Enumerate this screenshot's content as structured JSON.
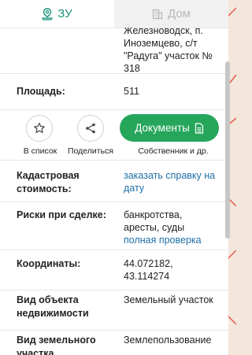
{
  "tabs": [
    {
      "label": "ЗУ",
      "icon": "land-plot-icon",
      "active": true
    },
    {
      "label": "Дом",
      "icon": "building-icon",
      "active": false
    }
  ],
  "address": {
    "lines": [
      "Железноводск, п.",
      "Иноземцево, с/т",
      "\"Радуга\" участок №",
      "318"
    ]
  },
  "area": {
    "label": "Площадь:",
    "value": "511"
  },
  "actions": {
    "favorite_label": "В список",
    "favorite_icon": "star-icon",
    "share_label": "Поделиться",
    "share_icon": "share-icon",
    "documents_label": "Документы",
    "documents_icon": "document-icon",
    "documents_sub": "Собственник и др."
  },
  "cadastral": {
    "label_lines": [
      "Кадастровая",
      "стоимость:"
    ],
    "link_lines": [
      "заказать справку на",
      "дату"
    ]
  },
  "risks": {
    "label": "Риски при сделке:",
    "value_lines": [
      "банкротства,",
      "аресты, суды"
    ],
    "link": "полная проверка"
  },
  "coordinates": {
    "label": "Координаты:",
    "value_lines": [
      "44.072182,",
      "43.114274"
    ]
  },
  "object_type": {
    "label_lines": [
      "Вид объекта",
      "недвижимости"
    ],
    "value": "Земельный участок"
  },
  "land_use": {
    "label_lines": [
      "Вид земельного",
      "участка"
    ],
    "value": "Землепользование"
  },
  "colors": {
    "accent": "#1b8f7a",
    "button_green": "#26a65b",
    "link": "#1f6fa8",
    "map_line": "#e8584a"
  }
}
